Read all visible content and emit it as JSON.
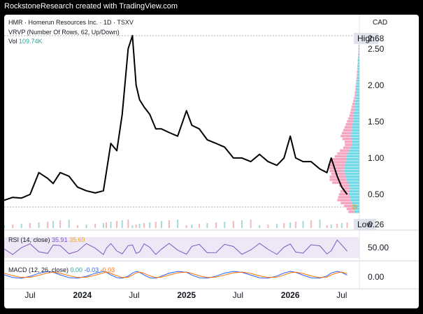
{
  "header": {
    "credit": "RockstoneResearch created with TradingView.com"
  },
  "legend": {
    "symbol_line": "HMR · Homerun Resources Inc. · 1D · TSXV",
    "vrvp_line": "VRVP (Number Of Rows, 62, Up/Down)",
    "vol_label": "Vol",
    "vol_value": "109.74K"
  },
  "currency": "CAD",
  "high_label": "High",
  "high_value": "2.68",
  "low_label": "Low",
  "low_value": "0.26",
  "d_marker": "D",
  "rsi": {
    "label": "RSI (14, close)",
    "value": "35.91",
    "ma": "35.69",
    "axis": "50.00"
  },
  "macd": {
    "label": "MACD (12, 26, close)",
    "hist": "0.00",
    "macd": "-0.03",
    "signal": "-0.03",
    "axis": "0.00"
  },
  "colors": {
    "price_line": "#000000",
    "rsi_line": "#7e57c2",
    "rsi_band": "#ede7f6",
    "macd_line": "#2962ff",
    "signal_line": "#ff6d00",
    "vp_up": "#4dd0e1",
    "vp_down": "#f48fb1"
  },
  "chart_data": {
    "type": "line",
    "title": "HMR · Homerun Resources Inc. · 1D · TSXV",
    "ylabel": "CAD",
    "ylim": [
      0.26,
      2.68
    ],
    "yticks": [
      0.5,
      1.0,
      1.5,
      2.0,
      2.5
    ],
    "ytick_labels": [
      "0.50",
      "1.00",
      "1.50",
      "2.00",
      "2.50"
    ],
    "xtick_labels": [
      "Jul",
      "2024",
      "Jul",
      "2025",
      "Jul",
      "2026",
      "Jul"
    ],
    "xtick_dates": [
      "2023-07-01",
      "2024-01-01",
      "2024-07-01",
      "2025-01-01",
      "2025-07-01",
      "2026-01-01",
      "2026-07-01"
    ],
    "xlim": [
      "2023-04-01",
      "2026-09-01"
    ],
    "series": [
      {
        "x": [
          "2023-04-01",
          "2023-05-01",
          "2023-06-01",
          "2023-07-01",
          "2023-08-01",
          "2023-09-01",
          "2023-09-20",
          "2023-10-15",
          "2023-11-15",
          "2023-12-15",
          "2024-01-15",
          "2024-02-15",
          "2024-03-15",
          "2024-03-25",
          "2024-04-10",
          "2024-05-01",
          "2024-05-20",
          "2024-06-10",
          "2024-06-25",
          "2024-07-08",
          "2024-07-20",
          "2024-08-05",
          "2024-08-25",
          "2024-09-15",
          "2024-10-05",
          "2024-11-01",
          "2024-12-01",
          "2025-01-01",
          "2025-01-20",
          "2025-02-15",
          "2025-03-15",
          "2025-04-15",
          "2025-05-15",
          "2025-06-15",
          "2025-07-15",
          "2025-08-15",
          "2025-09-15",
          "2025-10-15",
          "2025-11-15",
          "2025-12-10",
          "2026-01-01",
          "2026-01-20",
          "2026-02-15",
          "2026-03-15",
          "2026-04-15",
          "2026-05-10",
          "2026-05-25",
          "2026-06-15",
          "2026-07-01",
          "2026-07-20"
        ],
        "values": [
          0.42,
          0.46,
          0.45,
          0.5,
          0.8,
          0.72,
          0.65,
          0.8,
          0.75,
          0.6,
          0.55,
          0.52,
          0.55,
          0.8,
          1.2,
          1.1,
          1.6,
          2.5,
          2.68,
          2.0,
          1.8,
          1.7,
          1.6,
          1.4,
          1.4,
          1.35,
          1.3,
          1.65,
          1.45,
          1.4,
          1.25,
          1.2,
          1.15,
          1.0,
          1.0,
          0.95,
          1.05,
          0.95,
          0.9,
          1.0,
          1.3,
          1.0,
          0.95,
          0.95,
          0.85,
          0.8,
          1.0,
          0.75,
          0.6,
          0.5
        ]
      }
    ],
    "volume_profile": {
      "rows": 62,
      "price_levels": [
        0.26,
        0.3,
        0.34,
        0.38,
        0.42,
        0.46,
        0.5,
        0.54,
        0.58,
        0.62,
        0.66,
        0.7,
        0.74,
        0.78,
        0.82,
        0.86,
        0.9,
        0.94,
        0.98,
        1.02,
        1.06,
        1.1,
        1.14,
        1.18,
        1.22,
        1.26,
        1.3,
        1.34,
        1.38,
        1.42,
        1.46,
        1.5,
        1.54,
        1.58,
        1.62,
        1.66,
        1.7,
        1.74,
        1.78,
        1.82,
        1.86,
        1.9,
        1.94,
        1.98,
        2.02,
        2.06,
        2.1,
        2.14,
        2.18,
        2.22,
        2.26,
        2.3,
        2.34,
        2.38,
        2.42,
        2.46,
        2.5,
        2.54,
        2.58,
        2.62,
        2.66,
        2.68
      ],
      "up": [
        0.3,
        0.35,
        0.4,
        0.45,
        0.5,
        0.55,
        0.6,
        0.62,
        0.55,
        0.6,
        0.7,
        0.75,
        0.8,
        0.85,
        0.9,
        0.88,
        0.85,
        0.8,
        0.78,
        0.75,
        0.7,
        0.6,
        0.5,
        0.45,
        0.42,
        0.45,
        0.5,
        0.48,
        0.45,
        0.42,
        0.4,
        0.38,
        0.36,
        0.34,
        0.32,
        0.3,
        0.28,
        0.26,
        0.24,
        0.22,
        0.2,
        0.2,
        0.18,
        0.18,
        0.16,
        0.15,
        0.14,
        0.12,
        0.12,
        0.1,
        0.1,
        0.08,
        0.08,
        0.07,
        0.06,
        0.05,
        0.05,
        0.04,
        0.04,
        0.03,
        0.03,
        0.02
      ],
      "down": [
        0.35,
        0.4,
        0.5,
        0.65,
        0.8,
        0.7,
        0.6,
        0.5,
        0.45,
        0.6,
        0.9,
        1.0,
        0.95,
        0.8,
        0.85,
        0.9,
        1.0,
        0.95,
        0.85,
        0.7,
        0.6,
        0.55,
        0.45,
        0.4,
        0.45,
        0.55,
        0.6,
        0.55,
        0.5,
        0.45,
        0.4,
        0.35,
        0.3,
        0.25,
        0.22,
        0.2,
        0.18,
        0.15,
        0.12,
        0.1,
        0.08,
        0.07,
        0.06,
        0.05,
        0.04,
        0.04,
        0.03,
        0.03,
        0.03,
        0.02,
        0.02,
        0.02,
        0.02,
        0.01,
        0.01,
        0.01,
        0.01,
        0.01,
        0.01,
        0.01,
        0.01,
        0.01
      ]
    }
  }
}
